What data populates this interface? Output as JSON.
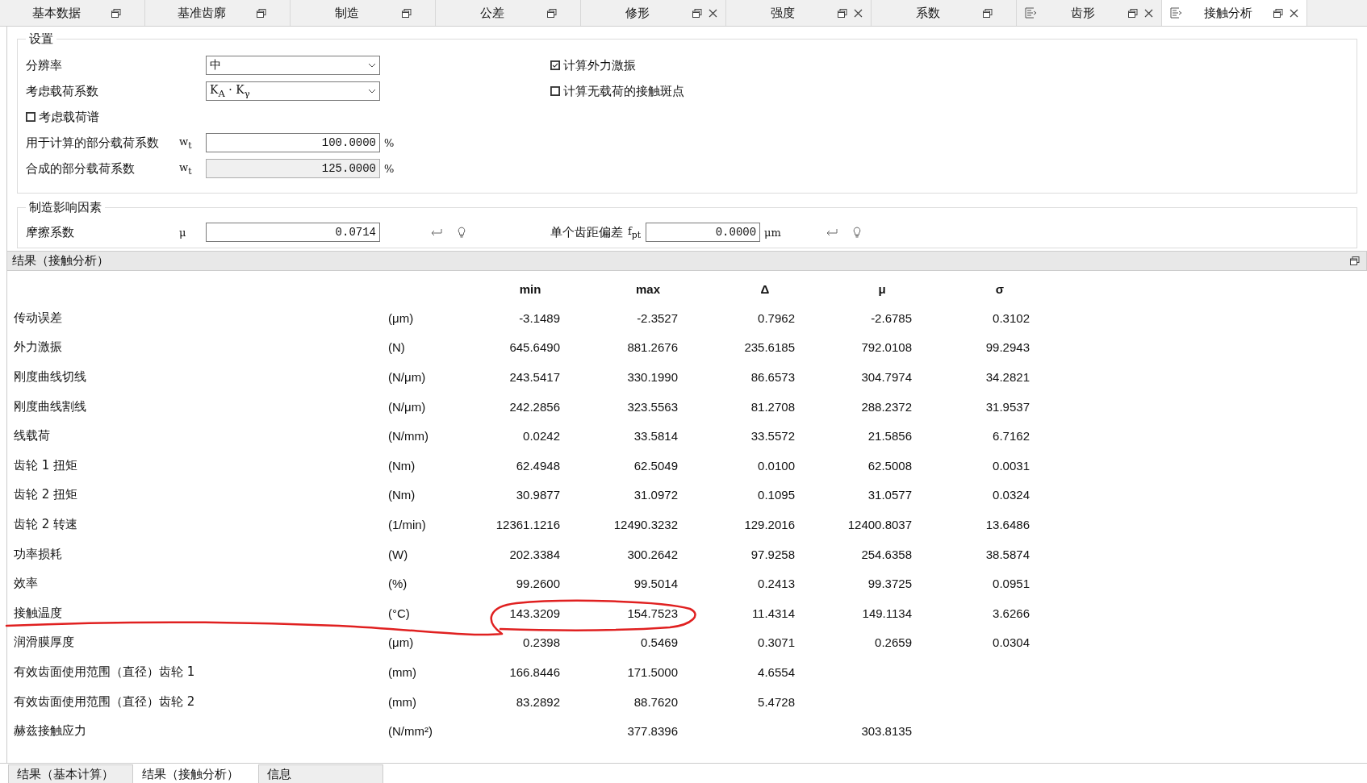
{
  "tabs": [
    {
      "label": "基本数据",
      "icon": false,
      "closable": false,
      "selected": false
    },
    {
      "label": "基准齿廓",
      "icon": false,
      "closable": false,
      "selected": false
    },
    {
      "label": "制造",
      "icon": false,
      "closable": false,
      "selected": false
    },
    {
      "label": "公差",
      "icon": false,
      "closable": false,
      "selected": false
    },
    {
      "label": "修形",
      "icon": false,
      "closable": true,
      "selected": false
    },
    {
      "label": "强度",
      "icon": false,
      "closable": true,
      "selected": false
    },
    {
      "label": "系数",
      "icon": false,
      "closable": false,
      "selected": false
    },
    {
      "label": "齿形",
      "icon": true,
      "closable": true,
      "selected": false
    },
    {
      "label": "接触分析",
      "icon": true,
      "closable": true,
      "selected": true
    }
  ],
  "settings": {
    "title": "设置",
    "left": [
      {
        "kind": "select",
        "label": "分辨率",
        "value": "中"
      },
      {
        "kind": "select",
        "label": "考虑载荷系数",
        "value": "K$_{A}$ · K$_{γ}$"
      },
      {
        "kind": "checkbox",
        "label": "考虑载荷谱",
        "checked": false
      },
      {
        "kind": "number",
        "label": "用于计算的部分载荷系数",
        "symbol": "w$_{t}$",
        "value": "100.0000",
        "unit": "%",
        "readonly": false
      },
      {
        "kind": "number",
        "label": "合成的部分载荷系数",
        "symbol": "w$_{t}$",
        "value": "125.0000",
        "unit": "%",
        "readonly": true
      }
    ],
    "right": [
      {
        "label": "计算外力激振",
        "checked": true
      },
      {
        "label": "计算无载荷的接触斑点",
        "checked": false
      }
    ]
  },
  "manufacturing": {
    "title": "制造影响因素",
    "fields": [
      {
        "label": "摩擦系数",
        "symbol": "μ",
        "value": "0.0714"
      },
      {
        "label": "单个齿距偏差",
        "symbol": "f$_{pt}$",
        "value": "0.0000",
        "unit": "μm"
      }
    ]
  },
  "results": {
    "title": "结果（接触分析）",
    "columns": [
      "min",
      "max",
      "Δ",
      "μ",
      "σ"
    ],
    "rows": [
      {
        "name": "传动误差",
        "unit": "(μm)",
        "min": "-3.1489",
        "max": "-2.3527",
        "delta": "0.7962",
        "mu": "-2.6785",
        "sigma": "0.3102"
      },
      {
        "name": "外力激振",
        "unit": "(N)",
        "min": "645.6490",
        "max": "881.2676",
        "delta": "235.6185",
        "mu": "792.0108",
        "sigma": "99.2943"
      },
      {
        "name": "刚度曲线切线",
        "unit": "(N/μm)",
        "min": "243.5417",
        "max": "330.1990",
        "delta": "86.6573",
        "mu": "304.7974",
        "sigma": "34.2821"
      },
      {
        "name": "刚度曲线割线",
        "unit": "(N/μm)",
        "min": "242.2856",
        "max": "323.5563",
        "delta": "81.2708",
        "mu": "288.2372",
        "sigma": "31.9537"
      },
      {
        "name": "线载荷",
        "unit": "(N/mm)",
        "min": "0.0242",
        "max": "33.5814",
        "delta": "33.5572",
        "mu": "21.5856",
        "sigma": "6.7162"
      },
      {
        "name": "齿轮 1 扭矩",
        "unit": "(Nm)",
        "min": "62.4948",
        "max": "62.5049",
        "delta": "0.0100",
        "mu": "62.5008",
        "sigma": "0.0031"
      },
      {
        "name": "齿轮 2 扭矩",
        "unit": "(Nm)",
        "min": "30.9877",
        "max": "31.0972",
        "delta": "0.1095",
        "mu": "31.0577",
        "sigma": "0.0324"
      },
      {
        "name": "齿轮 2 转速",
        "unit": "(1/min)",
        "min": "12361.1216",
        "max": "12490.3232",
        "delta": "129.2016",
        "mu": "12400.8037",
        "sigma": "13.6486"
      },
      {
        "name": "功率损耗",
        "unit": "(W)",
        "min": "202.3384",
        "max": "300.2642",
        "delta": "97.9258",
        "mu": "254.6358",
        "sigma": "38.5874"
      },
      {
        "name": "效率",
        "unit": "(%)",
        "min": "99.2600",
        "max": "99.5014",
        "delta": "0.2413",
        "mu": "99.3725",
        "sigma": "0.0951"
      },
      {
        "name": "接触温度",
        "unit": "(°C)",
        "min": "143.3209",
        "max": "154.7523",
        "delta": "11.4314",
        "mu": "149.1134",
        "sigma": "3.6266"
      },
      {
        "name": "润滑膜厚度",
        "unit": "(μm)",
        "min": "0.2398",
        "max": "0.5469",
        "delta": "0.3071",
        "mu": "0.2659",
        "sigma": "0.0304"
      },
      {
        "name": "有效齿面使用范围（直径）齿轮 1",
        "unit": "(mm)",
        "min": "166.8446",
        "max": "171.5000",
        "delta": "4.6554"
      },
      {
        "name": "有效齿面使用范围（直径）齿轮 2",
        "unit": "(mm)",
        "min": "83.2892",
        "max": "88.7620",
        "delta": "5.4728"
      },
      {
        "name": "赫兹接触应力",
        "unit": "(N/mm²)",
        "max": "377.8396",
        "mu": "303.8135"
      }
    ]
  },
  "bottom_tabs": [
    {
      "label": "结果（基本计算）",
      "selected": false
    },
    {
      "label": "结果（接触分析）",
      "selected": true
    },
    {
      "label": "信息",
      "selected": false
    }
  ]
}
